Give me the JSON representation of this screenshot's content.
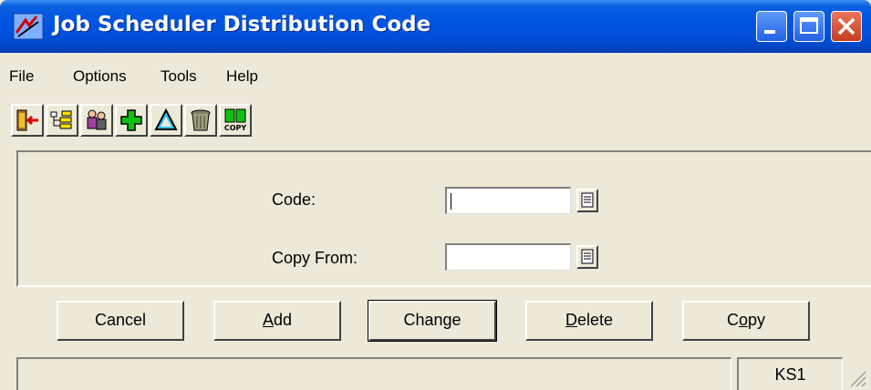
{
  "window": {
    "title": "Job Scheduler Distribution Code",
    "title_color": "#ffffff",
    "titlebar_color": "#0054e3",
    "controls": {
      "minimize_icon": "minimize-icon",
      "maximize_icon": "maximize-icon",
      "close_icon": "close-icon"
    }
  },
  "menu": {
    "items": [
      "File",
      "Options",
      "Tools",
      "Help"
    ]
  },
  "toolbar": {
    "buttons": [
      {
        "icon": "exit-icon"
      },
      {
        "icon": "tree-icon"
      },
      {
        "icon": "people-icon"
      },
      {
        "icon": "add-icon"
      },
      {
        "icon": "change-icon"
      },
      {
        "icon": "trash-icon"
      },
      {
        "icon": "copy-icon",
        "text": "COPY"
      }
    ]
  },
  "form": {
    "code_label": "Code:",
    "code_value": "",
    "copy_from_label": "Copy From:",
    "copy_from_value": ""
  },
  "buttons": {
    "cancel": "Cancel",
    "add_accel": "A",
    "add_rest": "dd",
    "change": "Change",
    "delete_accel": "D",
    "delete_rest": "elete",
    "copy_pre": "C",
    "copy_accel": "o",
    "copy_rest": "py"
  },
  "status": {
    "main": "",
    "system": "KS1"
  }
}
